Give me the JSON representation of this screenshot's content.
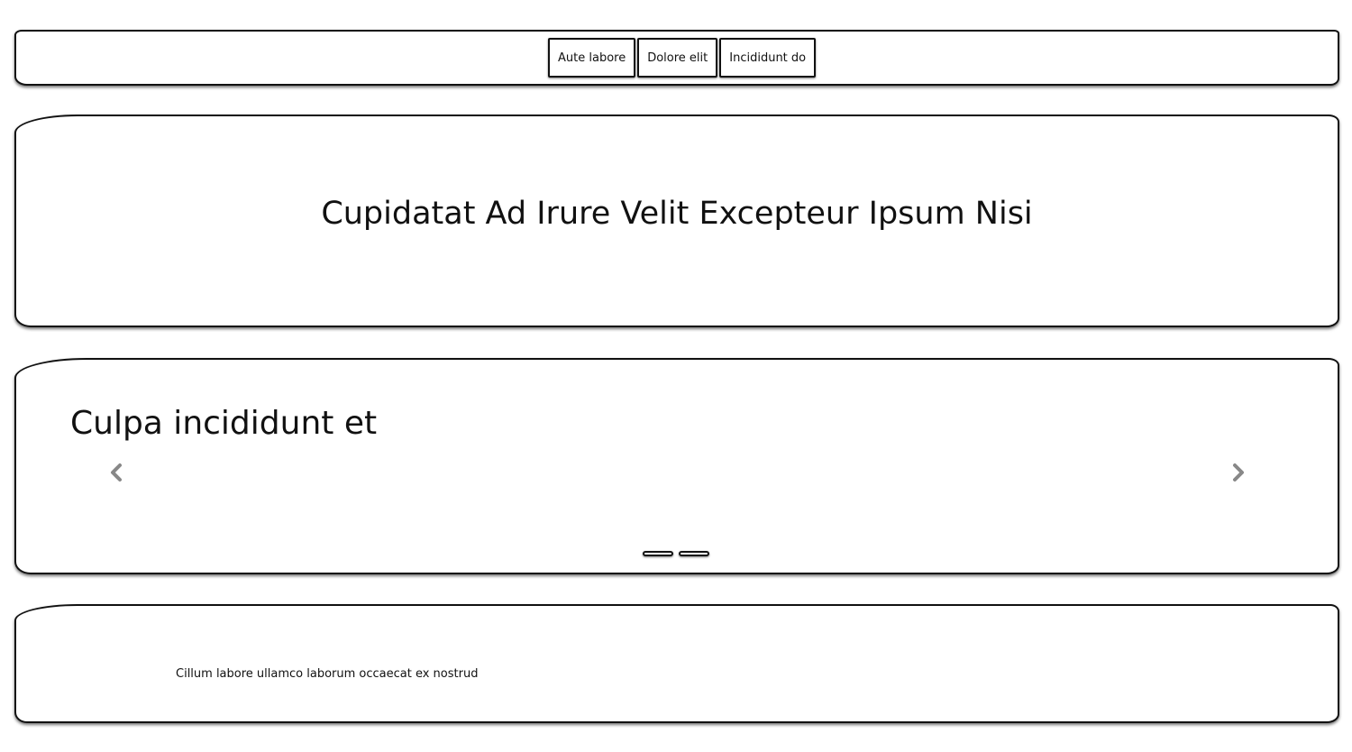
{
  "nav": {
    "items": [
      {
        "label": "Aute labore"
      },
      {
        "label": "Dolore elit"
      },
      {
        "label": "Incididunt do"
      }
    ]
  },
  "hero": {
    "title": "Cupidatat Ad Irure Velit Excepteur Ipsum Nisi"
  },
  "carousel": {
    "slide_title": "Culpa incididunt et",
    "prev_icon": "chevron-left-icon",
    "next_icon": "chevron-right-icon",
    "indicator_count": 2
  },
  "footer": {
    "text": "Cillum labore ullamco laborum occaecat ex nostrud"
  },
  "colors": {
    "border": "#111111",
    "arrow": "#888888",
    "background": "#ffffff"
  }
}
